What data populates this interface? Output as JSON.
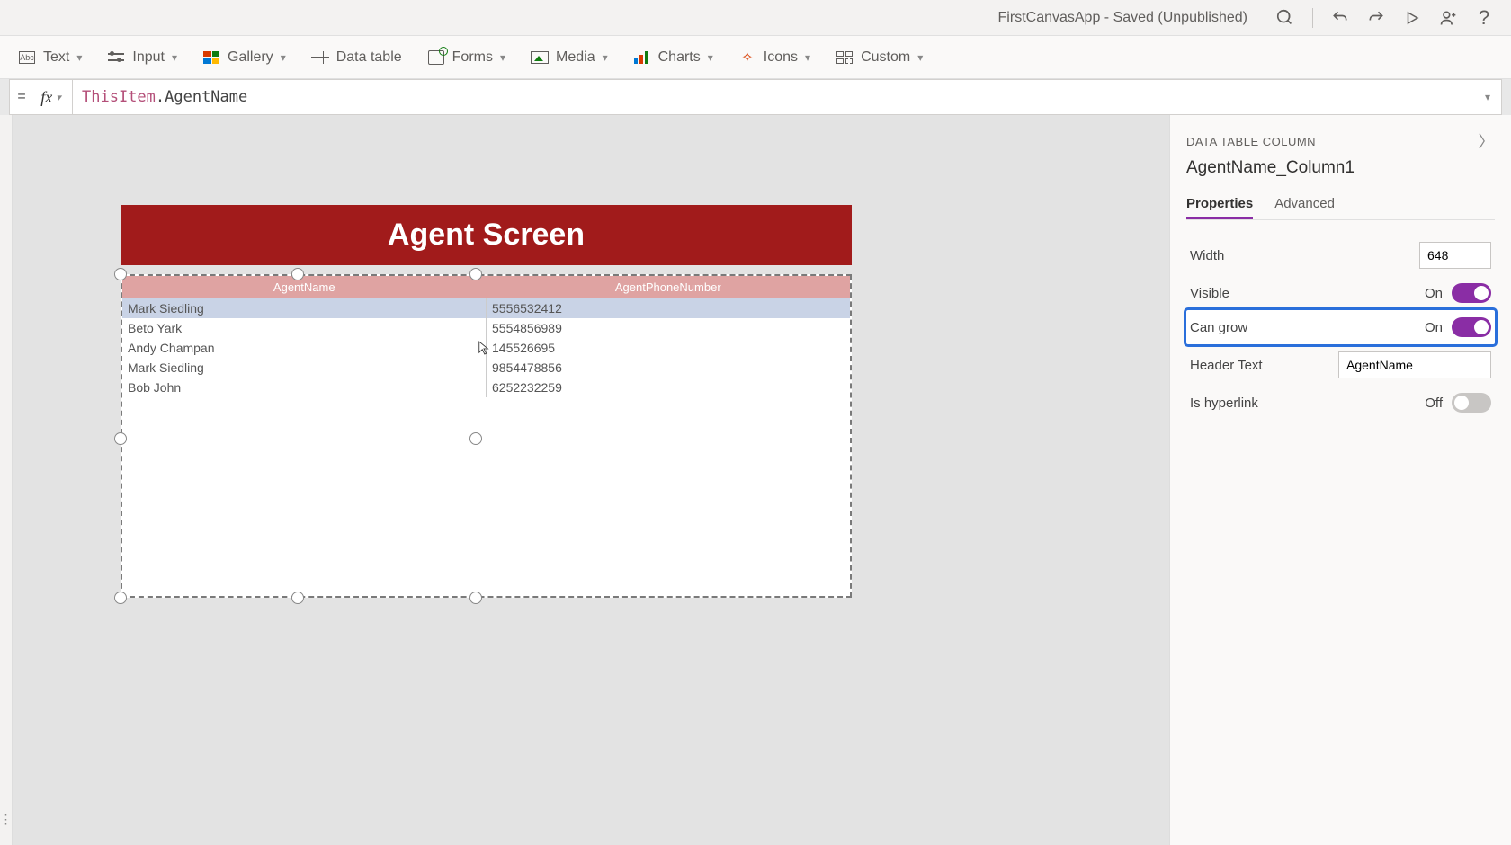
{
  "titlebar": {
    "app_title": "FirstCanvasApp - Saved (Unpublished)"
  },
  "ribbon": {
    "text": "Text",
    "input": "Input",
    "gallery": "Gallery",
    "data_table": "Data table",
    "forms": "Forms",
    "media": "Media",
    "charts": "Charts",
    "icons": "Icons",
    "custom": "Custom"
  },
  "formula": {
    "prefix": "ThisItem",
    "rest": ".AgentName"
  },
  "canvas": {
    "screen_title": "Agent Screen",
    "columns": [
      "AgentName",
      "AgentPhoneNumber"
    ],
    "rows": [
      {
        "name": "Mark Siedling",
        "phone": "5556532412"
      },
      {
        "name": "Beto Yark",
        "phone": "5554856989"
      },
      {
        "name": "Andy Champan",
        "phone": "145526695"
      },
      {
        "name": "Mark Siedling",
        "phone": "9854478856"
      },
      {
        "name": "Bob John",
        "phone": "6252232259"
      }
    ]
  },
  "properties": {
    "panel_label": "DATA TABLE COLUMN",
    "object_name": "AgentName_Column1",
    "tabs": {
      "properties": "Properties",
      "advanced": "Advanced"
    },
    "width_label": "Width",
    "width_value": "648",
    "visible_label": "Visible",
    "visible_state": "On",
    "cangrow_label": "Can grow",
    "cangrow_state": "On",
    "headertext_label": "Header Text",
    "headertext_value": "AgentName",
    "ishyperlink_label": "Is hyperlink",
    "ishyperlink_state": "Off"
  }
}
